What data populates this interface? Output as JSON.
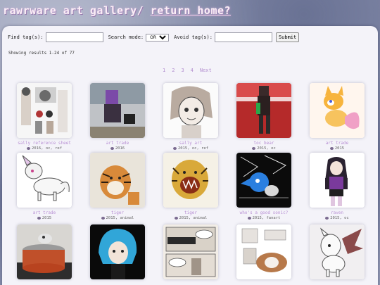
{
  "header": {
    "site_title": "rawrware art gallery/",
    "home_link": "return home?"
  },
  "search": {
    "find_label": "Find tag(s):",
    "mode_label": "Search mode:",
    "mode_selected": "OR",
    "avoid_label": "Avoid tag(s):",
    "submit_label": "Submit",
    "find_value": "",
    "avoid_value": ""
  },
  "results": {
    "text": "Showing results 1-24 of 77"
  },
  "pagination": {
    "pages": [
      "1",
      "2",
      "3",
      "4"
    ],
    "next_label": "Next"
  },
  "gallery": {
    "items": [
      {
        "title": "sally reference sheet",
        "meta": "2016, oc, ref",
        "icon": "eye-icon"
      },
      {
        "title": "art trade",
        "meta": "2016",
        "icon": "eye-icon"
      },
      {
        "title": "sally art",
        "meta": "2015, oc, ref",
        "icon": "eye-icon"
      },
      {
        "title": "toc bear",
        "meta": "2015, oc",
        "icon": "eye-icon"
      },
      {
        "title": "art trade",
        "meta": "2015",
        "icon": "eye-icon"
      },
      {
        "title": "art trade",
        "meta": "2015",
        "icon": "eye-icon"
      },
      {
        "title": "tiger",
        "meta": "2015, animal",
        "icon": "eye-icon"
      },
      {
        "title": "tiger",
        "meta": "2015, animal",
        "icon": "eye-icon"
      },
      {
        "title": "who's a good sonic?",
        "meta": "2015, fanart",
        "icon": "eye-icon"
      },
      {
        "title": "raven",
        "meta": "2015, oc",
        "icon": "eye-icon"
      },
      {
        "title": "",
        "meta": "",
        "icon": ""
      },
      {
        "title": "",
        "meta": "",
        "icon": ""
      },
      {
        "title": "",
        "meta": "",
        "icon": ""
      },
      {
        "title": "",
        "meta": "",
        "icon": ""
      },
      {
        "title": "",
        "meta": "",
        "icon": ""
      }
    ]
  },
  "colors": {
    "background": "#8f96b3",
    "panel": "#f4f3f9",
    "link_purple": "#b890d4",
    "title_text": "#fbeef6"
  }
}
